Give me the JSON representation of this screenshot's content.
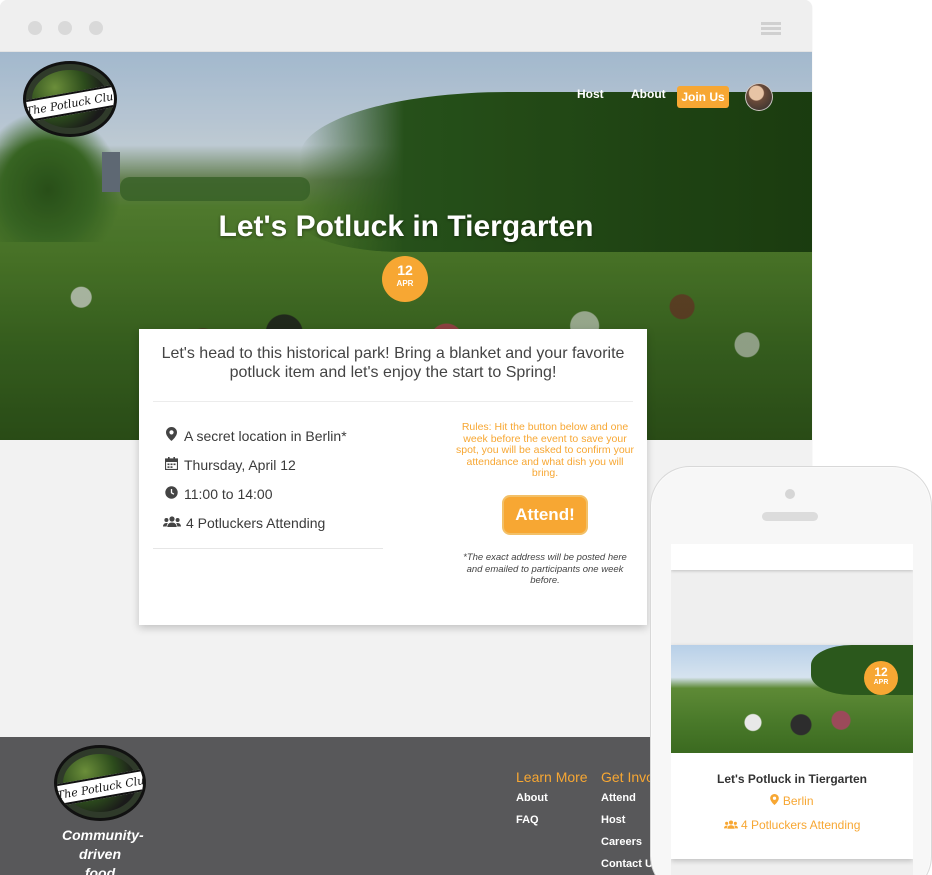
{
  "nav": {
    "host": "Host",
    "about": "About",
    "join": "Join Us"
  },
  "logo": {
    "text": "The Potluck Club"
  },
  "hero": {
    "title": "Let's Potluck in Tiergarten",
    "date_day": "12",
    "date_month": "APR"
  },
  "card": {
    "lead": "Let's head to this historical park! Bring a blanket and your favorite potluck item and let's enjoy the start to Spring!",
    "details": [
      {
        "icon": "map-marker-icon",
        "text": "A secret location in Berlin*"
      },
      {
        "icon": "calendar-icon",
        "text": "Thursday, April 12"
      },
      {
        "icon": "clock-icon",
        "text": "11:00 to 14:00"
      },
      {
        "icon": "users-icon",
        "text": "4 Potluckers Attending"
      }
    ],
    "rules": "Rules: Hit the button below and one week before the event to save your spot, you will be asked to confirm your attendance and what dish you will bring.",
    "attend_button": "Attend!",
    "note": "*The exact address will be posted here and emailed to participants one week before."
  },
  "footer": {
    "tagline": "Community-driven food events",
    "learn_more": {
      "heading": "Learn More",
      "links": [
        "About",
        "FAQ"
      ]
    },
    "get_involved": {
      "heading": "Get Involved",
      "links": [
        "Attend",
        "Host",
        "Careers",
        "Contact Us"
      ]
    }
  },
  "phone": {
    "date_day": "12",
    "date_month": "APR",
    "title": "Let's Potluck in Tiergarten",
    "location": "Berlin",
    "attending": "4 Potluckers Attending"
  },
  "colors": {
    "accent": "#f7a733",
    "footer_bg": "#58585a"
  }
}
